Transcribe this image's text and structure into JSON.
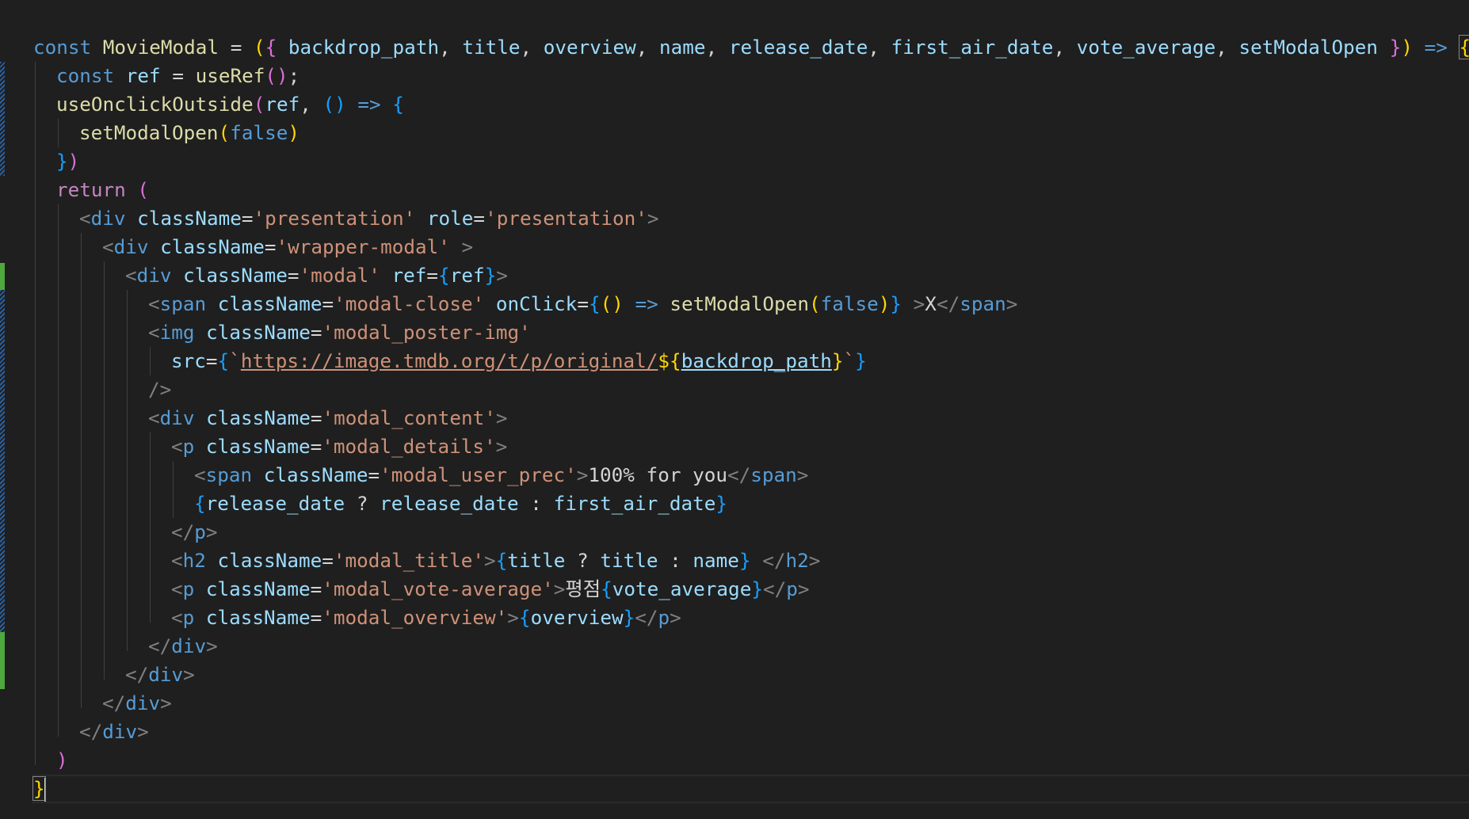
{
  "editor": {
    "language": "javascript-react",
    "lines": [
      "const MovieModal = ({ backdrop_path, title, overview, name, release_date, first_air_date, vote_average, setModalOpen }) => {",
      "  const ref = useRef();",
      "  useOnclickOutside(ref, () => {",
      "    setModalOpen(false)",
      "  })",
      "  return (",
      "    <div className='presentation' role='presentation'>",
      "      <div className='wrapper-modal' >",
      "        <div className='modal' ref={ref}>",
      "          <span className='modal-close' onClick={() => setModalOpen(false)} >X</span>",
      "          <img className='modal_poster-img'",
      "            src={`https://image.tmdb.org/t/p/original/${backdrop_path}`}",
      "          />",
      "          <div className='modal_content'>",
      "            <p className='modal_details'>",
      "              <span className='modal_user_prec'>100% for you</span>",
      "              {release_date ? release_date : first_air_date}",
      "            </p>",
      "            <h2 className='modal_title'>{title ? title : name} </h2>",
      "            <p className='modal_vote-average'>평점{vote_average}</p>",
      "            <p className='modal_overview'>{overview}</p>",
      "          </div>",
      "        </div>",
      "      </div>",
      "    </div>",
      "  )",
      "}"
    ]
  },
  "theme": {
    "background": "#1f1f1f",
    "keyword": "#569cd6",
    "control": "#c586c0",
    "function": "#dcdcaa",
    "variable": "#9cdcfe",
    "string": "#ce9178",
    "bracket_gold": "#ffd700",
    "bracket_orchid": "#da70d6",
    "bracket_blue": "#179fff",
    "git_added": "#4fa83d",
    "git_modified": "#2a5f9e"
  }
}
